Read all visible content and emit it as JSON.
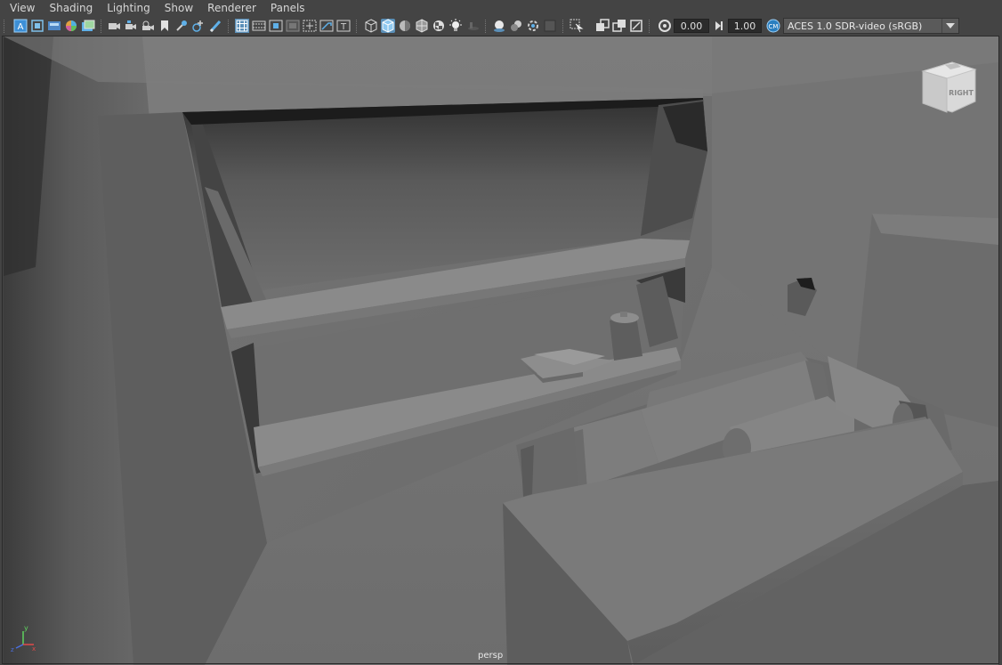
{
  "menu": {
    "items": [
      "View",
      "Shading",
      "Lighting",
      "Show",
      "Renderer",
      "Panels"
    ]
  },
  "toolbar": {
    "exposure_value": "0.00",
    "gamma_value": "1.00",
    "color_space": "ACES 1.0 SDR-video (sRGB)",
    "accent_color": "#5ca8d8"
  },
  "viewport": {
    "camera_name": "persp",
    "view_cube_label": "RIGHT",
    "axis_labels": {
      "x": "x",
      "y": "y",
      "z": "z"
    }
  }
}
